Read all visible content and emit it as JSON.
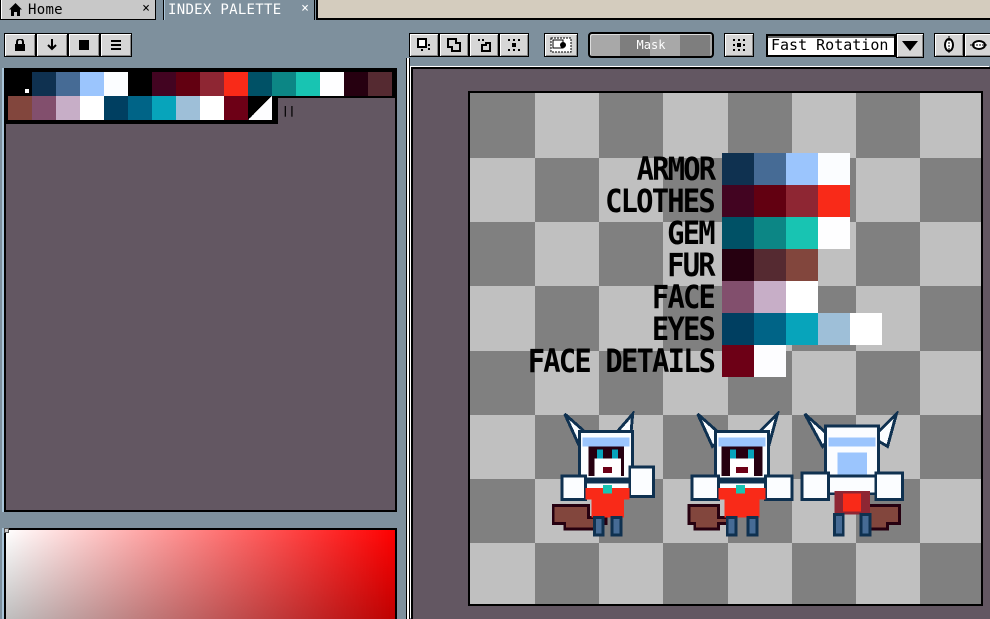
{
  "tabs": [
    {
      "label": "Home",
      "icon": "home-icon",
      "close": "×",
      "active": false
    },
    {
      "label": "INDEX PALETTE",
      "close": "×",
      "active": true
    }
  ],
  "palette_toolbar": {
    "buttons": [
      {
        "name": "lock-button",
        "icon": "lock-icon"
      },
      {
        "name": "down-arrow-button",
        "icon": "arrow-down-icon"
      },
      {
        "name": "square-button",
        "icon": "square-icon"
      },
      {
        "name": "menu-button",
        "icon": "menu-icon"
      }
    ]
  },
  "palette": {
    "row1": [
      "#000000",
      "#0f3150",
      "#466b95",
      "#9bc5fd",
      "#fbfdff",
      "#000000",
      "#420421",
      "#620011",
      "#8e2633",
      "#f92a18",
      "#005166",
      "#0c8685",
      "#18c4b2",
      "#fefeff",
      "#260010",
      "#552a31"
    ],
    "row2": [
      "#82463d",
      "#824f6d",
      "#c7aec7",
      "#ffffff",
      "#003f61",
      "#006487",
      "#07a4bb",
      "#9ebfd8",
      "#ffffff",
      "#6d0016",
      "#fdfdff"
    ],
    "marker": "||"
  },
  "canvas_toolbar": {
    "buttons": [
      {
        "name": "select-rect-button",
        "icon": "select-rect-icon"
      },
      {
        "name": "select-shape-button",
        "icon": "select-shape-icon"
      },
      {
        "name": "select-subtract-button",
        "icon": "select-subtract-icon"
      },
      {
        "name": "select-intersect-button",
        "icon": "select-intersect-icon"
      },
      {
        "name": "select-invert-button",
        "icon": "select-invert-icon"
      }
    ],
    "mask_label": "Mask",
    "grid_button_icon": "grid-icon",
    "rotation_select": "Fast Rotation",
    "flip_h_icon": "flip-horizontal-icon",
    "flip_v_icon": "flip-vertical-icon"
  },
  "legend": [
    {
      "label": "ARMOR",
      "colors": [
        "#0f3150",
        "#466b95",
        "#9bc5fd",
        "#fbfdff"
      ]
    },
    {
      "label": "CLOTHES",
      "colors": [
        "#420421",
        "#620011",
        "#8e2633",
        "#f92a18"
      ]
    },
    {
      "label": "GEM",
      "colors": [
        "#005166",
        "#0c8685",
        "#18c4b2",
        "#fefeff"
      ]
    },
    {
      "label": "FUR",
      "colors": [
        "#260010",
        "#552a31",
        "#82463d"
      ]
    },
    {
      "label": "FACE",
      "colors": [
        "#824f6d",
        "#c7aec7",
        "#ffffff"
      ]
    },
    {
      "label": "EYES",
      "colors": [
        "#003f61",
        "#006487",
        "#07a4bb",
        "#9ebfd8",
        "#ffffff"
      ]
    },
    {
      "label": "FACE DETAILS",
      "colors": [
        "#6d0016",
        "#fdfdff"
      ]
    }
  ],
  "sprites": [
    {
      "name": "sprite-front-left",
      "view": "front"
    },
    {
      "name": "sprite-front-center",
      "view": "front"
    },
    {
      "name": "sprite-back",
      "view": "back"
    }
  ],
  "colors": {
    "panel_bg": "#635762",
    "chrome": "#7e909d",
    "checker_dark": "#808080",
    "checker_light": "#c0c0c0",
    "gradient_hue": "#ff0000"
  }
}
